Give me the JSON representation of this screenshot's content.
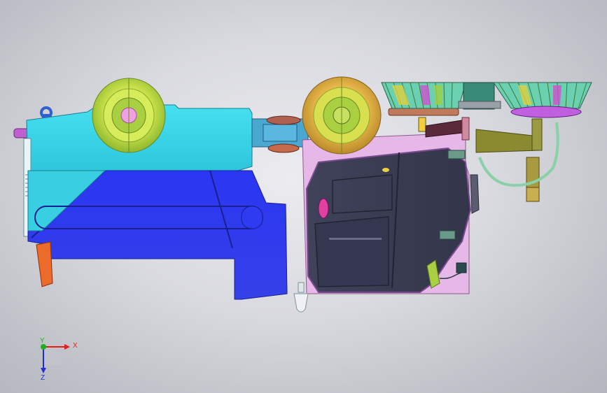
{
  "viewport": {
    "background": "gradient-grey",
    "model": "cleaning-machine-assembly",
    "colors": {
      "body_cyan": "#3fd8ea",
      "body_blue": "#2e3bf0",
      "cabinet": "#3a3c52",
      "wheel_yellow": "#c9e24a",
      "hub_magenta": "#e066d8",
      "brush_fan": "#6ad0b0"
    }
  },
  "triad": {
    "x_label": "X",
    "y_label": "Y",
    "z_label": "Z",
    "x_color": "#e02020",
    "y_color": "#20b020",
    "z_color": "#2030d0"
  }
}
